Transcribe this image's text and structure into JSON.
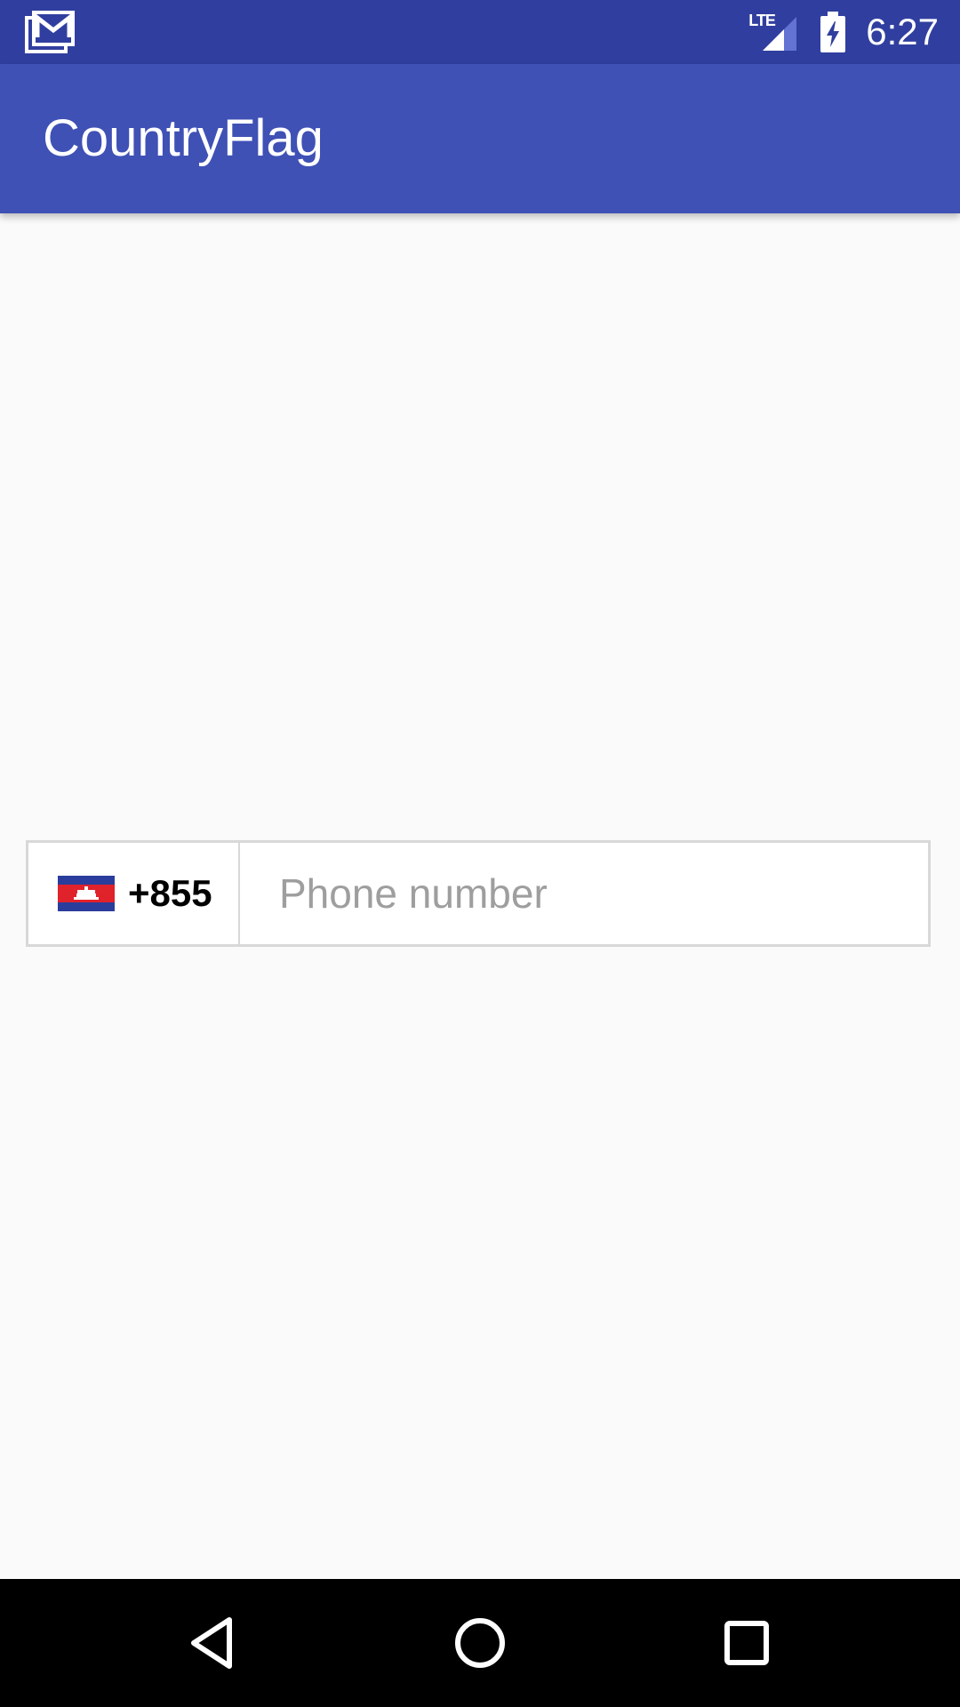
{
  "status_bar": {
    "notification_icon": "gmail-icon",
    "network_label": "LTE",
    "signal_icon": "signal-icon",
    "battery_icon": "battery-charging-icon",
    "time": "6:27"
  },
  "app_bar": {
    "title": "CountryFlag"
  },
  "phone_field": {
    "country_flag_icon": "cambodia-flag-icon",
    "dial_code": "+855",
    "placeholder": "Phone number",
    "value": ""
  },
  "nav_bar": {
    "back_icon": "back-triangle-icon",
    "home_icon": "home-circle-icon",
    "recents_icon": "recents-square-icon"
  },
  "colors": {
    "status_bar": "#303f9f",
    "app_bar": "#3f51b5",
    "background": "#fafafa",
    "placeholder": "#9e9e9e"
  }
}
